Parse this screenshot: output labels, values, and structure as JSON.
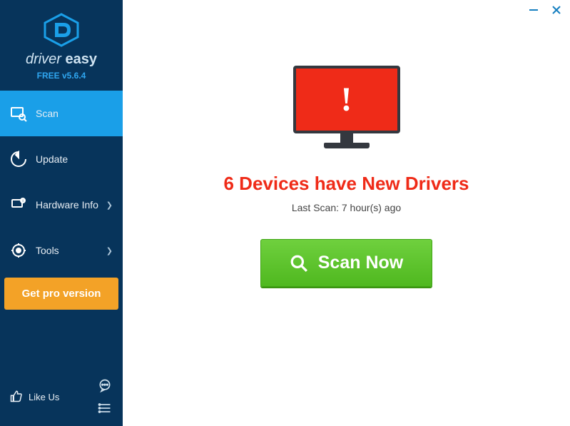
{
  "brand": {
    "name_part1": "driver",
    "name_part2": "easy",
    "version": "FREE v5.6.4"
  },
  "nav": {
    "scan": "Scan",
    "update": "Update",
    "hardware": "Hardware Info",
    "tools": "Tools"
  },
  "get_pro": "Get pro version",
  "like_us": "Like Us",
  "main": {
    "headline": "6 Devices have New Drivers",
    "last_scan": "Last Scan: 7 hour(s) ago",
    "scan_button": "Scan Now"
  },
  "colors": {
    "sidebar": "#07345b",
    "active": "#1a9fe8",
    "alert": "#ef2b18",
    "pro": "#f3a227",
    "scan": "#5bc629"
  }
}
